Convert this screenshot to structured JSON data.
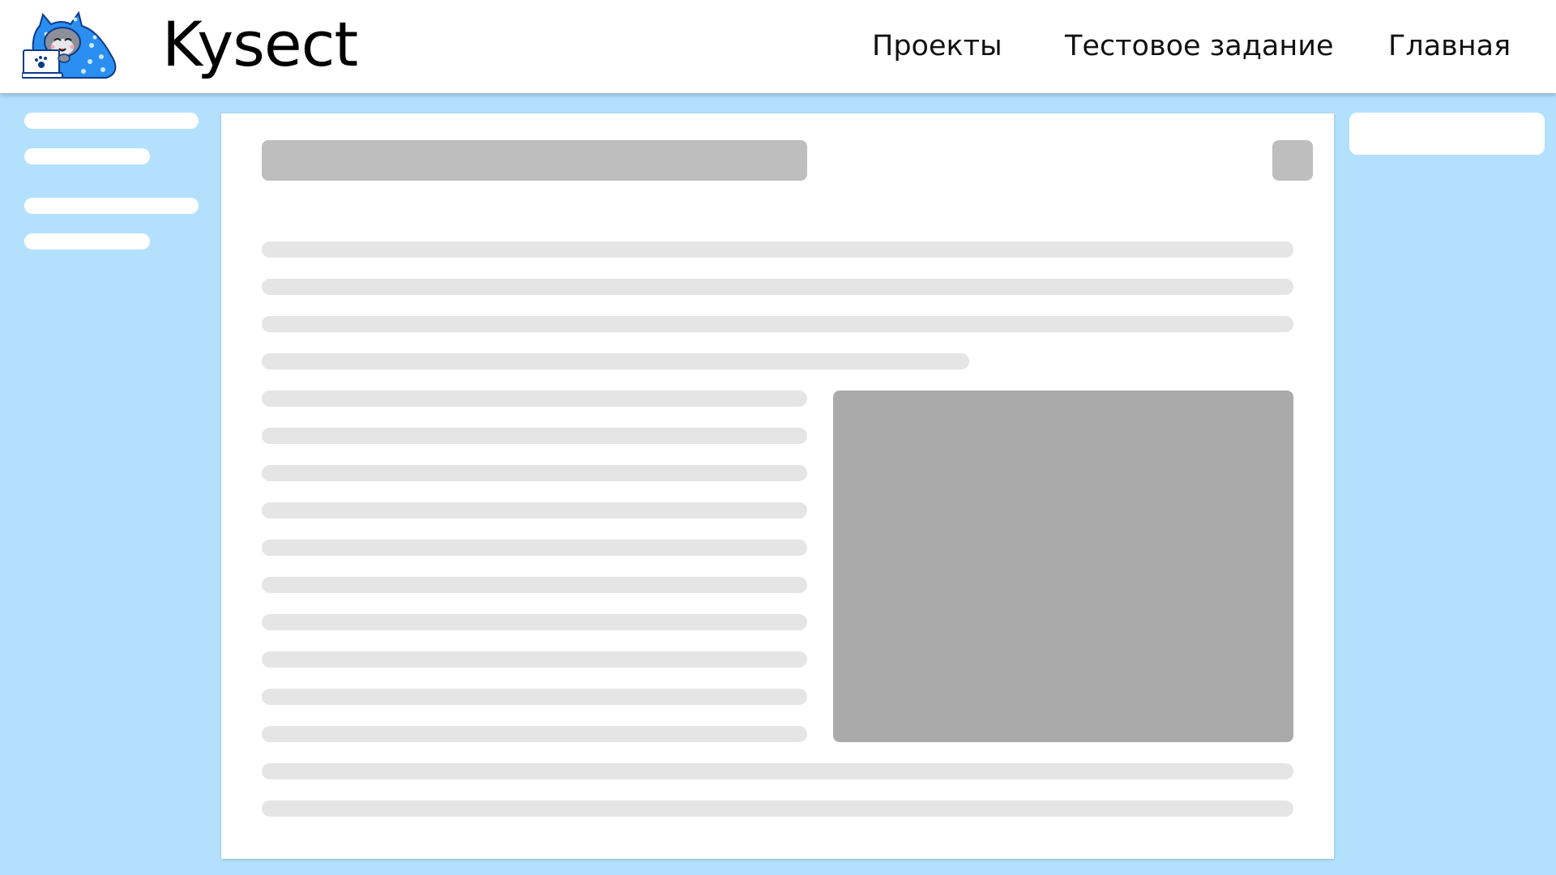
{
  "header": {
    "brand": "Kysect",
    "logo_icon": "cat-mascot-with-laptop-icon",
    "nav": [
      {
        "label": "Проекты"
      },
      {
        "label": "Тестовое задание"
      },
      {
        "label": "Главная"
      }
    ]
  },
  "colors": {
    "page_background": "#b3e1fd",
    "header_background": "#ffffff",
    "skeleton_line": "#e5e5e5",
    "skeleton_title": "#bebebe",
    "skeleton_image": "#aaaaaa",
    "logo_blue": "#2a8ff0"
  }
}
